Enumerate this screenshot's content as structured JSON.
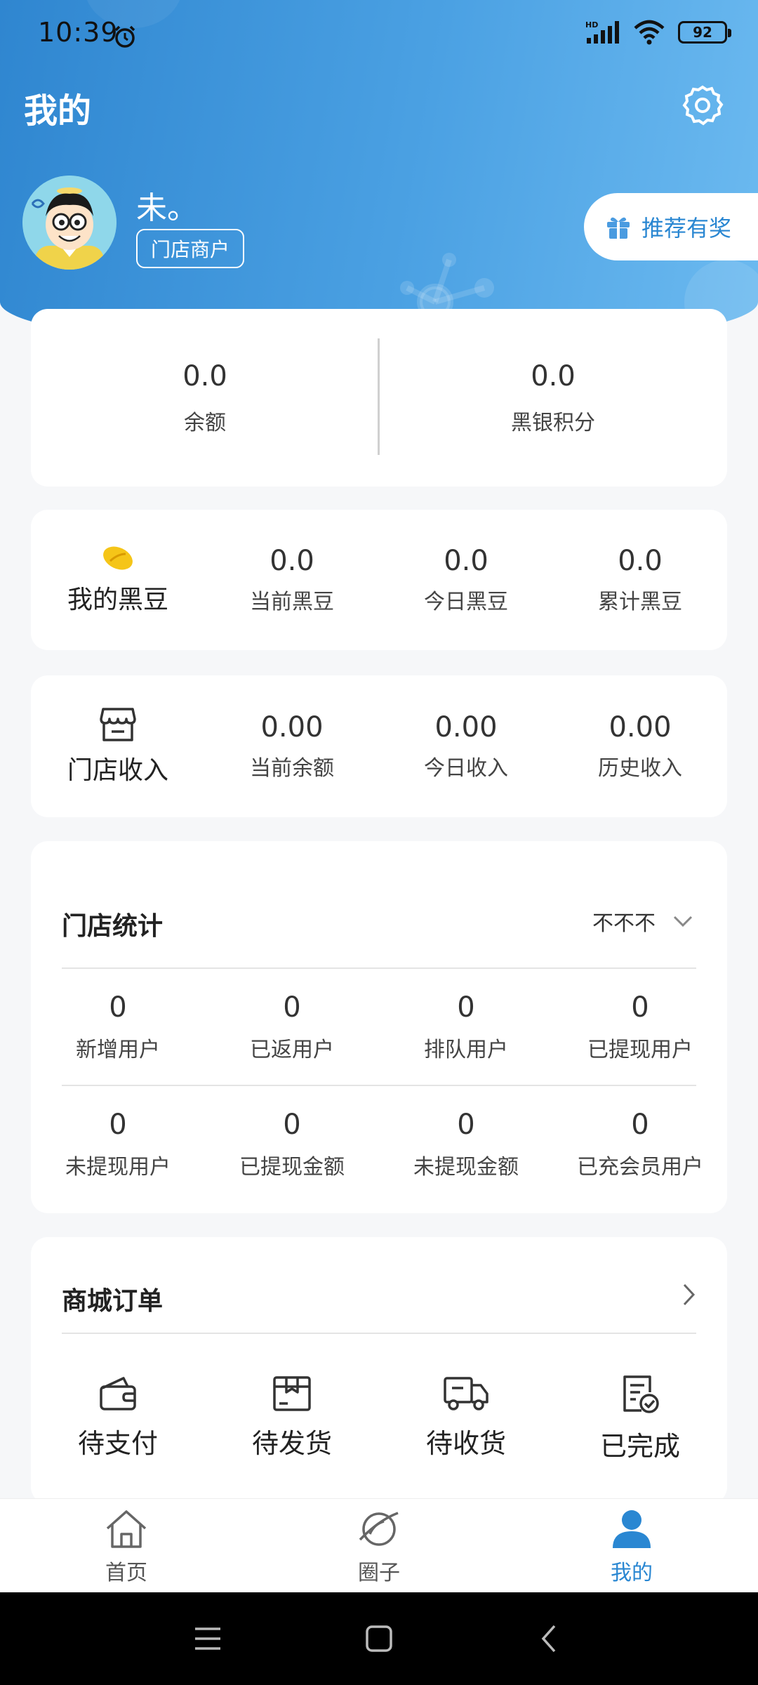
{
  "status_bar": {
    "time": "10:39",
    "network": "HD",
    "battery": "92"
  },
  "header": {
    "title": "我的"
  },
  "profile": {
    "username": "未。",
    "role": "门店商户",
    "referral_label": "推荐有奖"
  },
  "balance": {
    "items": [
      {
        "value": "0.0",
        "label": "余额"
      },
      {
        "value": "0.0",
        "label": "黑银积分"
      }
    ]
  },
  "beans": {
    "title": "我的黑豆",
    "items": [
      {
        "value": "0.0",
        "label": "当前黑豆"
      },
      {
        "value": "0.0",
        "label": "今日黑豆"
      },
      {
        "value": "0.0",
        "label": "累计黑豆"
      }
    ]
  },
  "store_income": {
    "title": "门店收入",
    "items": [
      {
        "value": "0.00",
        "label": "当前余额"
      },
      {
        "value": "0.00",
        "label": "今日收入"
      },
      {
        "value": "0.00",
        "label": "历史收入"
      }
    ]
  },
  "store_stats": {
    "title": "门店统计",
    "filter": "不不不",
    "rows": [
      [
        {
          "value": "0",
          "label": "新增用户"
        },
        {
          "value": "0",
          "label": "已返用户"
        },
        {
          "value": "0",
          "label": "排队用户"
        },
        {
          "value": "0",
          "label": "已提现用户"
        }
      ],
      [
        {
          "value": "0",
          "label": "未提现用户"
        },
        {
          "value": "0",
          "label": "已提现金额"
        },
        {
          "value": "0",
          "label": "未提现金额"
        },
        {
          "value": "0",
          "label": "已充会员用户"
        }
      ]
    ]
  },
  "orders": {
    "title": "商城订单",
    "items": [
      {
        "label": "待支付",
        "icon": "wallet-icon"
      },
      {
        "label": "待发货",
        "icon": "box-icon"
      },
      {
        "label": "待收货",
        "icon": "truck-icon"
      },
      {
        "label": "已完成",
        "icon": "checklist-icon"
      }
    ]
  },
  "tabs": [
    {
      "label": "首页",
      "icon": "home-icon"
    },
    {
      "label": "圈子",
      "icon": "planet-icon"
    },
    {
      "label": "我的",
      "icon": "person-icon",
      "active": true
    }
  ],
  "colors": {
    "brand": "#2a87d2",
    "hero_start": "#2f86d0",
    "hero_end": "#6cbaf0",
    "bean": "#f5c518"
  }
}
